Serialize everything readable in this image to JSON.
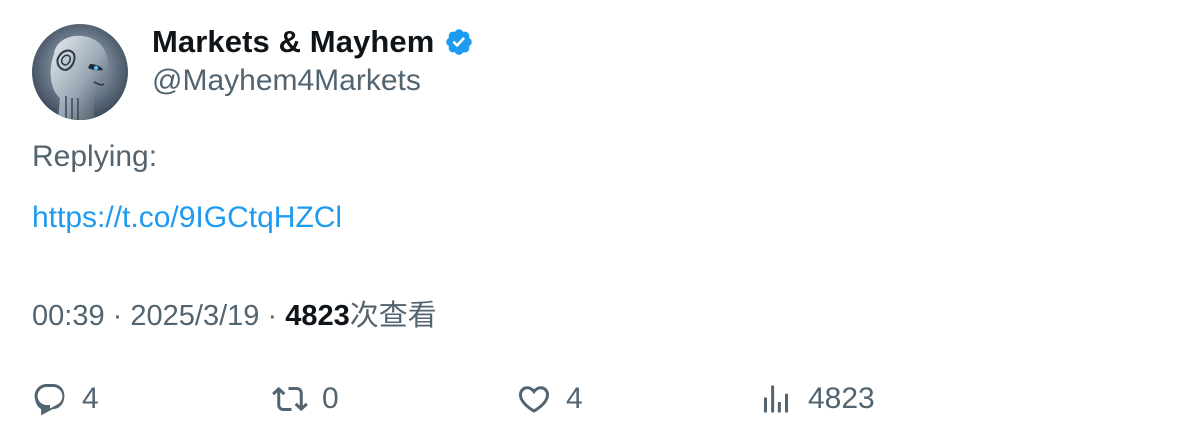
{
  "author": {
    "display_name": "Markets & Mayhem",
    "handle": "@Mayhem4Markets",
    "verified": true,
    "verified_color": "#1d9bf0",
    "avatar_icon": "robot-avatar"
  },
  "tweet": {
    "reply_text": "Replying:",
    "link_text": "https://t.co/9IGCtqHZCl",
    "time": "00:39",
    "separator": "·",
    "date": "2025/3/19",
    "views_count": "4823",
    "views_label": "次查看"
  },
  "actions": {
    "reply": {
      "icon": "reply-icon",
      "count": "4"
    },
    "retweet": {
      "icon": "retweet-icon",
      "count": "0"
    },
    "like": {
      "icon": "heart-icon",
      "count": "4"
    },
    "views": {
      "icon": "views-icon",
      "count": "4823"
    }
  },
  "colors": {
    "primary_text": "#0f1419",
    "secondary_text": "#536471",
    "link": "#1d9bf0"
  }
}
